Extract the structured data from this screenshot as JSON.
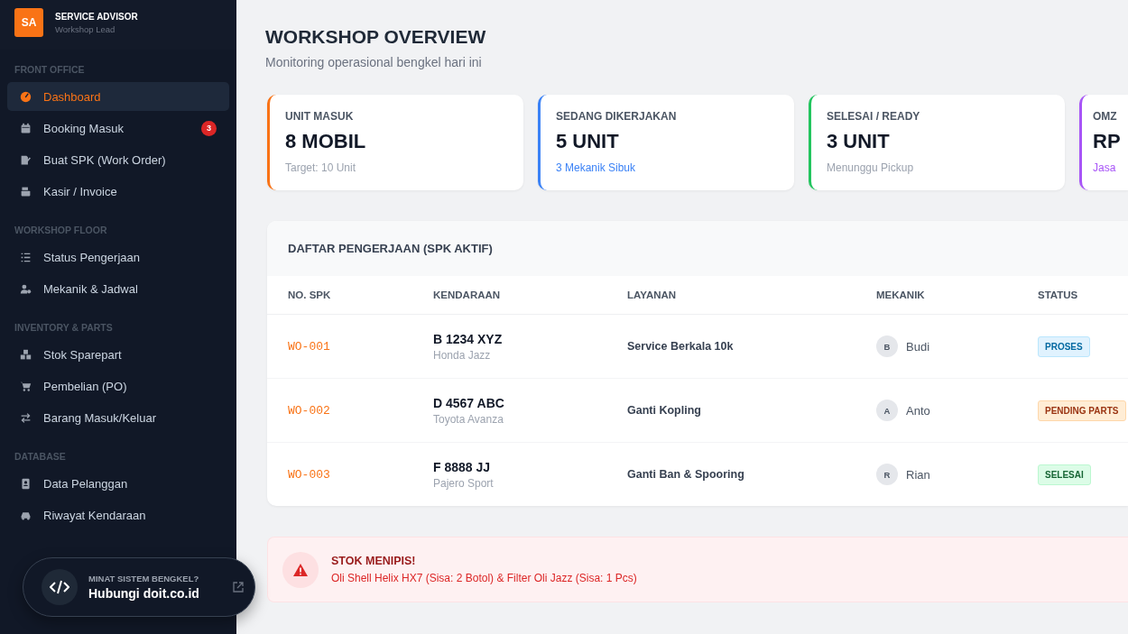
{
  "brand": {
    "logo": "SA",
    "title": "SERVICE ADVISOR",
    "subtitle": "Workshop Lead"
  },
  "sidebar": {
    "sections": [
      {
        "title": "FRONT OFFICE",
        "items": [
          {
            "label": "Dashboard",
            "selected": true
          },
          {
            "label": "Booking Masuk",
            "selected": false,
            "badge": "3"
          },
          {
            "label": "Buat SPK (Work Order)",
            "selected": false
          },
          {
            "label": "Kasir / Invoice",
            "selected": false
          }
        ]
      },
      {
        "title": "WORKSHOP FLOOR",
        "items": [
          {
            "label": "Status Pengerjaan",
            "selected": false
          },
          {
            "label": "Mekanik & Jadwal",
            "selected": false
          }
        ]
      },
      {
        "title": "INVENTORY & PARTS",
        "items": [
          {
            "label": "Stok Sparepart",
            "selected": false
          },
          {
            "label": "Pembelian (PO)",
            "selected": false
          },
          {
            "label": "Barang Masuk/Keluar",
            "selected": false
          }
        ]
      },
      {
        "title": "DATABASE",
        "items": [
          {
            "label": "Data Pelanggan",
            "selected": false
          },
          {
            "label": "Riwayat Kendaraan",
            "selected": false
          }
        ]
      }
    ]
  },
  "promo": {
    "eyebrow": "MINAT SISTEM BENGKEL?",
    "link": "Hubungi doit.co.id"
  },
  "page": {
    "title": "WORKSHOP OVERVIEW",
    "subtitle": "Monitoring operasional bengkel hari ini"
  },
  "stat_cards": [
    {
      "label": "UNIT MASUK",
      "value": "8 MOBIL",
      "note": "Target: 10 Unit",
      "color": "#f97316",
      "note_highlight": false
    },
    {
      "label": "SEDANG DIKERJAKAN",
      "value": "5 UNIT",
      "note": "3 Mekanik Sibuk",
      "color": "#3b82f6",
      "note_highlight": true
    },
    {
      "label": "SELESAI / READY",
      "value": "3 UNIT",
      "note": "Menunggu Pickup",
      "color": "#22c55e",
      "note_highlight": false
    },
    {
      "label": "OMZ",
      "value": "RP",
      "note": "Jasa",
      "color": "#a855f7",
      "note_highlight": true
    }
  ],
  "table": {
    "title": "DAFTAR PENGERJAAN (SPK AKTIF)",
    "columns": [
      "NO. SPK",
      "KENDARAAN",
      "LAYANAN",
      "MEKANIK",
      "STATUS"
    ],
    "rows": [
      {
        "spk": "WO-001",
        "plate": "B 1234 XYZ",
        "model": "Honda Jazz",
        "service": "Service Berkala 10k",
        "initial": "B",
        "mechanic": "Budi",
        "status": "PROSES",
        "kind": "process"
      },
      {
        "spk": "WO-002",
        "plate": "D 4567 ABC",
        "model": "Toyota Avanza",
        "service": "Ganti Kopling",
        "initial": "A",
        "mechanic": "Anto",
        "status": "PENDING PARTS",
        "kind": "pending"
      },
      {
        "spk": "WO-003",
        "plate": "F 8888 JJ",
        "model": "Pajero Sport",
        "service": "Ganti Ban & Spooring",
        "initial": "R",
        "mechanic": "Rian",
        "status": "SELESAI",
        "kind": "done"
      }
    ]
  },
  "alert": {
    "title": "STOK MENIPIS!",
    "message": "Oli Shell Helix HX7 (Sisa: 2 Botol) & Filter Oli Jazz (Sisa: 1 Pcs)"
  }
}
